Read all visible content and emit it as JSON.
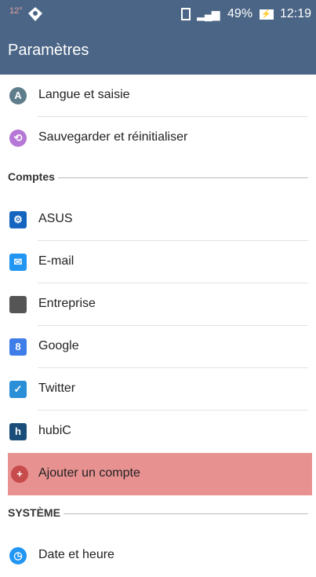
{
  "status_bar": {
    "left_text": "12°",
    "battery_percent": "49%",
    "time": "12:19",
    "color": "#4a6585"
  },
  "header": {
    "title": "Paramètres"
  },
  "list": [
    {
      "type": "item",
      "label": "Langue et saisie",
      "icon": "language-icon",
      "icon_text": "A",
      "icon_color": "#607d8b"
    },
    {
      "type": "item",
      "label": "Sauvegarder et réinitialiser",
      "icon": "backup-icon",
      "icon_text": "⟲",
      "icon_color": "#b678d6"
    },
    {
      "type": "section",
      "label": "Comptes"
    },
    {
      "type": "item",
      "label": "ASUS",
      "icon": "asus-icon",
      "icon_text": "⚙",
      "icon_color": "#1565c0"
    },
    {
      "type": "item",
      "label": "E-mail",
      "icon": "email-icon",
      "icon_text": "✉",
      "icon_color": "#2196f3"
    },
    {
      "type": "item",
      "label": "Entreprise",
      "icon": "enterprise-icon",
      "icon_text": "",
      "icon_color": "#555555"
    },
    {
      "type": "item",
      "label": "Google",
      "icon": "google-icon",
      "icon_text": "8",
      "icon_color": "#3f7de8"
    },
    {
      "type": "item",
      "label": "Twitter",
      "icon": "twitter-icon",
      "icon_text": "✓",
      "icon_color": "#2a8fd6"
    },
    {
      "type": "item",
      "label": "hubiC",
      "icon": "hubic-icon",
      "icon_text": "h",
      "icon_color": "#1a4d7a"
    },
    {
      "type": "item",
      "label": "Ajouter un compte",
      "icon": "add-icon",
      "icon_text": "+",
      "icon_color": "#c74b4b",
      "highlight": true
    },
    {
      "type": "section",
      "label": "SYSTÈME"
    },
    {
      "type": "item",
      "label": "Date et heure",
      "icon": "clock-icon",
      "icon_text": "◷",
      "icon_color": "#2196f3"
    }
  ]
}
